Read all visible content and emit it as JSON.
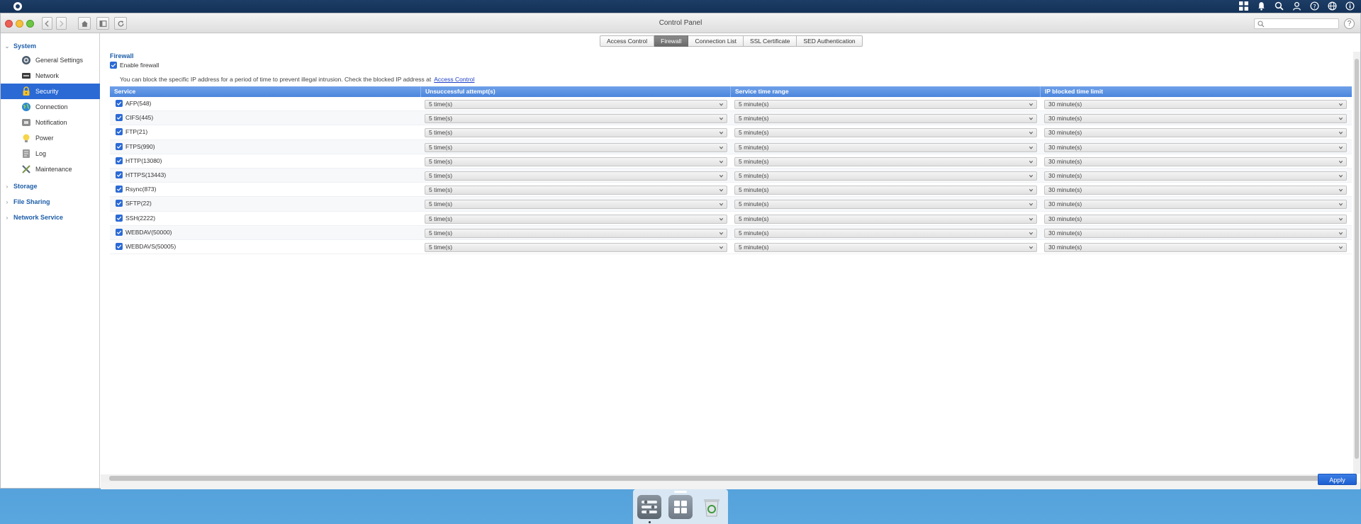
{
  "window": {
    "title": "Control Panel",
    "search_placeholder": ""
  },
  "sidebar": {
    "groups": [
      {
        "label": "System"
      },
      {
        "label": "Storage"
      },
      {
        "label": "File Sharing"
      },
      {
        "label": "Network Service"
      }
    ],
    "items": [
      {
        "label": "General Settings",
        "icon": "gear-icon"
      },
      {
        "label": "Network",
        "icon": "network-icon"
      },
      {
        "label": "Security",
        "icon": "lock-icon",
        "active": true
      },
      {
        "label": "Connection",
        "icon": "globe-icon"
      },
      {
        "label": "Notification",
        "icon": "notification-icon"
      },
      {
        "label": "Power",
        "icon": "bulb-icon"
      },
      {
        "label": "Log",
        "icon": "log-icon"
      },
      {
        "label": "Maintenance",
        "icon": "tools-icon"
      }
    ]
  },
  "tabs": [
    "Access Control",
    "Firewall",
    "Connection List",
    "SSL Certificate",
    "SED Authentication"
  ],
  "active_tab": "Firewall",
  "firewall": {
    "title": "Firewall",
    "enable_label": "Enable firewall",
    "hint_text": "You can block the specific IP address for a period of time to prevent illegal intrusion. Check the blocked IP address at",
    "hint_link": "Access Control"
  },
  "table": {
    "headers": [
      "Service",
      "Unsuccessful attempt(s)",
      "Service time range",
      "IP blocked time limit"
    ],
    "rows": [
      {
        "service": "AFP(548)",
        "attempts": "5 time(s)",
        "range": "5 minute(s)",
        "blocked": "30 minute(s)"
      },
      {
        "service": "CIFS(445)",
        "attempts": "5 time(s)",
        "range": "5 minute(s)",
        "blocked": "30 minute(s)"
      },
      {
        "service": "FTP(21)",
        "attempts": "5 time(s)",
        "range": "5 minute(s)",
        "blocked": "30 minute(s)"
      },
      {
        "service": "FTPS(990)",
        "attempts": "5 time(s)",
        "range": "5 minute(s)",
        "blocked": "30 minute(s)"
      },
      {
        "service": "HTTP(13080)",
        "attempts": "5 time(s)",
        "range": "5 minute(s)",
        "blocked": "30 minute(s)"
      },
      {
        "service": "HTTPS(13443)",
        "attempts": "5 time(s)",
        "range": "5 minute(s)",
        "blocked": "30 minute(s)"
      },
      {
        "service": "Rsync(873)",
        "attempts": "5 time(s)",
        "range": "5 minute(s)",
        "blocked": "30 minute(s)"
      },
      {
        "service": "SFTP(22)",
        "attempts": "5 time(s)",
        "range": "5 minute(s)",
        "blocked": "30 minute(s)"
      },
      {
        "service": "SSH(2222)",
        "attempts": "5 time(s)",
        "range": "5 minute(s)",
        "blocked": "30 minute(s)"
      },
      {
        "service": "WEBDAV(50000)",
        "attempts": "5 time(s)",
        "range": "5 minute(s)",
        "blocked": "30 minute(s)"
      },
      {
        "service": "WEBDAVS(50005)",
        "attempts": "5 time(s)",
        "range": "5 minute(s)",
        "blocked": "30 minute(s)"
      }
    ]
  },
  "apply_label": "Apply",
  "colors": {
    "accent": "#2b6ad5",
    "header": "#5b8fe0",
    "link": "#1d3fc7"
  }
}
